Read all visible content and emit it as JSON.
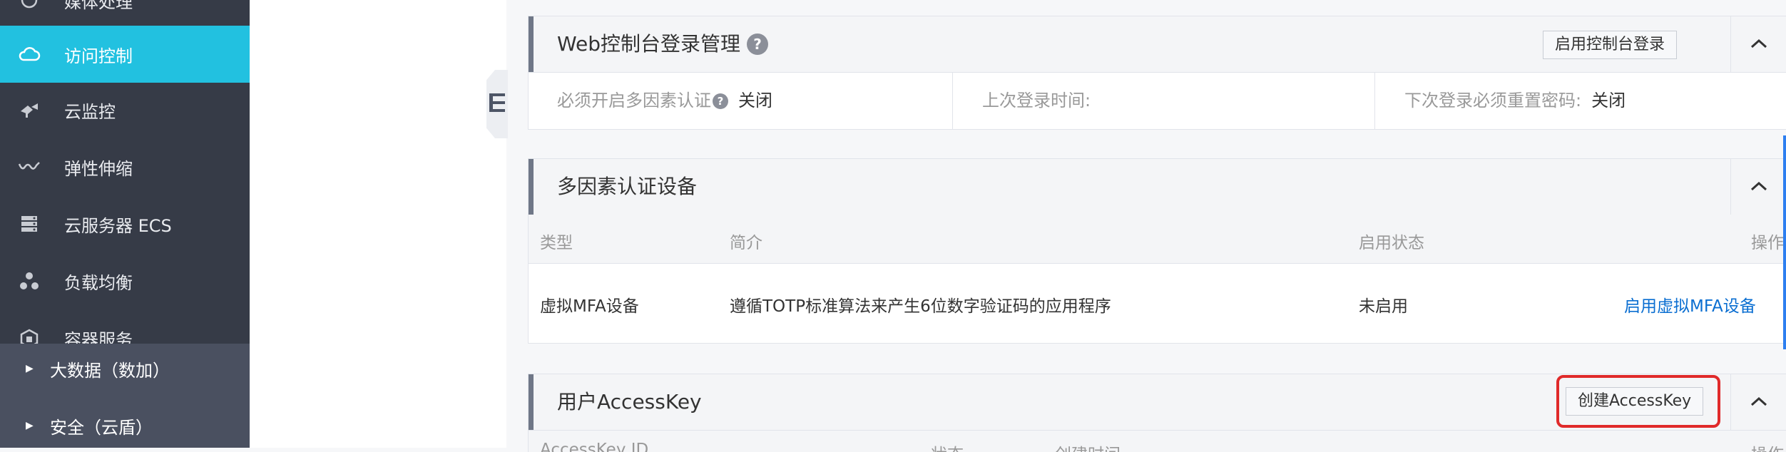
{
  "sidebar": {
    "items": [
      {
        "label": "媒体处理",
        "icon": "media-icon"
      },
      {
        "label": "访问控制",
        "icon": "cloud-icon",
        "active": true
      },
      {
        "label": "云监控",
        "icon": "monitor-icon"
      },
      {
        "label": "弹性伸缩",
        "icon": "scaling-icon"
      },
      {
        "label": "云服务器 ECS",
        "icon": "server-icon"
      },
      {
        "label": "负载均衡",
        "icon": "load-balance-icon"
      },
      {
        "label": "容器服务",
        "icon": "container-icon"
      }
    ],
    "groups": [
      {
        "label": "大数据（数加）"
      },
      {
        "label": "安全（云盾）"
      }
    ]
  },
  "console_login": {
    "title": "Web控制台登录管理",
    "help": "?",
    "enable_button": "启用控制台登录",
    "mfa_required_label": "必须开启多因素认证",
    "mfa_required_value": "关闭",
    "last_login_label": "上次登录时间:",
    "last_login_value": "",
    "reset_password_label": "下次登录必须重置密码:",
    "reset_password_value": "关闭"
  },
  "mfa": {
    "title": "多因素认证设备",
    "columns": [
      "类型",
      "简介",
      "启用状态",
      "操作"
    ],
    "rows": [
      {
        "type": "虚拟MFA设备",
        "description": "遵循TOTP标准算法来产生6位数字验证码的应用程序",
        "status": "未启用",
        "action": "启用虚拟MFA设备"
      }
    ]
  },
  "access_key": {
    "title": "用户AccessKey",
    "create_button": "创建AccessKey",
    "columns_partial": [
      "AccessKey ID",
      "状态",
      "创建时间",
      "操作"
    ]
  },
  "colors": {
    "sidebar_bg": "#363b47",
    "active_item": "#22c1e0",
    "link": "#0a6ed1",
    "highlight": "#e02a2a"
  }
}
